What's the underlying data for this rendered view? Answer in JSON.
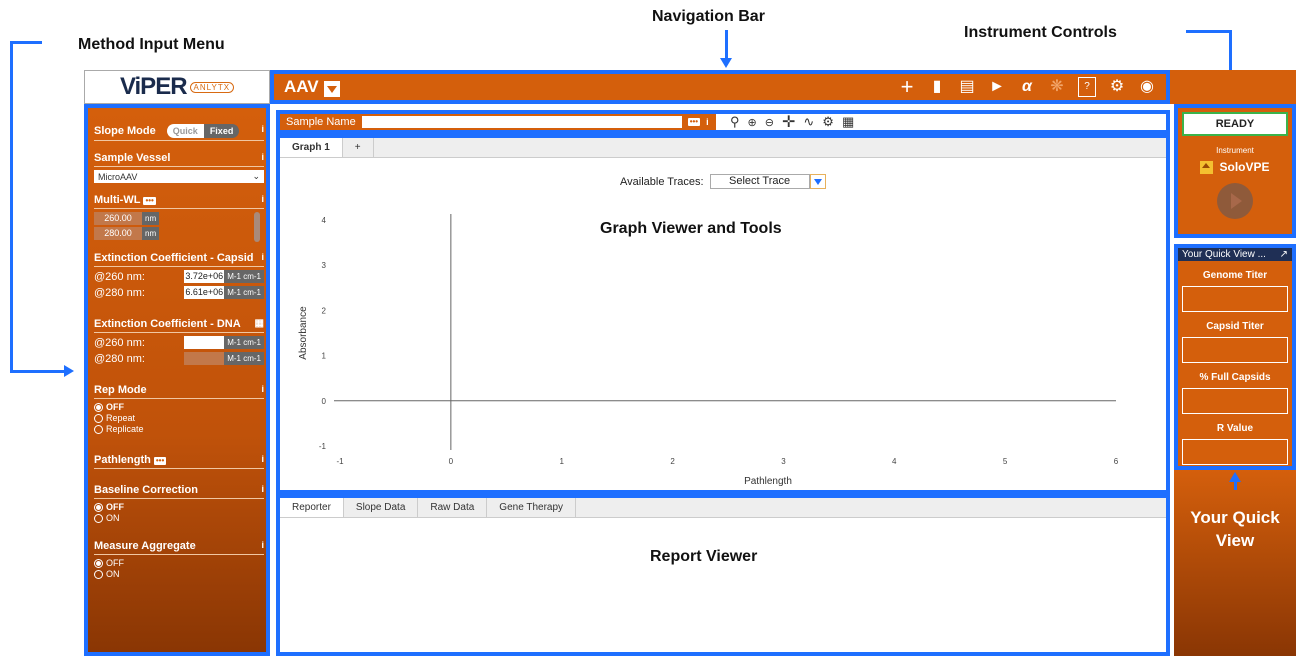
{
  "annotations": {
    "navigation_bar": "Navigation Bar",
    "method_input_menu": "Method Input Menu",
    "instrument_controls": "Instrument Controls",
    "graph_viewer": "Graph Viewer and Tools",
    "report_viewer": "Report Viewer",
    "your_quick_view": "Your Quick View"
  },
  "app": {
    "logo": "ViPER",
    "logo_sub": "ANLYTX",
    "project": "AAV"
  },
  "nav_icons": [
    "plus-icon",
    "folder-icon",
    "save-icon",
    "export-icon",
    "analyze-icon",
    "lamp-icon",
    "help-icon",
    "gear-icon",
    "user-icon"
  ],
  "method": {
    "slope_mode": {
      "label": "Slope Mode",
      "options": [
        "Quick",
        "Fixed"
      ],
      "selected": "Fixed"
    },
    "sample_vessel": {
      "label": "Sample Vessel",
      "value": "MicroAAV"
    },
    "multi_wl": {
      "label": "Multi-WL",
      "values": [
        "260.00",
        "280.00"
      ],
      "unit": "nm"
    },
    "ext_capsid": {
      "label": "Extinction Coefficient - Capsid",
      "rows": [
        {
          "label": "@260 nm:",
          "value": "3.72e+06",
          "unit": "M-1 cm-1"
        },
        {
          "label": "@280 nm:",
          "value": "6.61e+06",
          "unit": "M-1 cm-1"
        }
      ]
    },
    "ext_dna": {
      "label": "Extinction Coefficient - DNA",
      "rows": [
        {
          "label": "@260 nm:",
          "value": "",
          "unit": "M-1 cm-1"
        },
        {
          "label": "@280 nm:",
          "value": "",
          "unit": "M-1 cm-1"
        }
      ]
    },
    "rep_mode": {
      "label": "Rep Mode",
      "options": [
        "OFF",
        "Repeat",
        "Replicate"
      ],
      "selected": "OFF"
    },
    "pathlength": {
      "label": "Pathlength"
    },
    "baseline": {
      "label": "Baseline Correction",
      "options": [
        "OFF",
        "ON"
      ],
      "selected": "OFF"
    },
    "aggregate": {
      "label": "Measure Aggregate",
      "options": [
        "OFF",
        "ON"
      ],
      "selected": "OFF"
    },
    "info": "i"
  },
  "sample": {
    "label": "Sample Name",
    "value": "",
    "info": "i"
  },
  "graph_tools": [
    "zoom-reset-icon",
    "zoom-in-icon",
    "zoom-out-icon",
    "pan-icon",
    "trace-icon",
    "settings-icon",
    "table-icon"
  ],
  "graph": {
    "tabs": [
      "Graph 1",
      "+"
    ],
    "available_traces_label": "Available Traces:",
    "trace_select": "Select Trace"
  },
  "chart_data": {
    "type": "line",
    "xlabel": "Pathlength",
    "ylabel": "Absorbance",
    "xlim": [
      -1,
      6
    ],
    "ylim": [
      -1,
      4
    ],
    "x_ticks": [
      -1,
      0,
      1,
      2,
      3,
      4,
      5,
      6
    ],
    "y_ticks": [
      -1,
      0,
      1,
      2,
      3,
      4
    ],
    "series": []
  },
  "report": {
    "tabs": [
      "Reporter",
      "Slope Data",
      "Raw Data",
      "Gene Therapy"
    ]
  },
  "instrument": {
    "status": "READY",
    "label": "Instrument",
    "name": "SoloVPE"
  },
  "quick_view": {
    "header": "Your Quick View ...",
    "fields": [
      "Genome Titer",
      "Capsid Titer",
      "% Full Capsids",
      "R Value"
    ]
  }
}
